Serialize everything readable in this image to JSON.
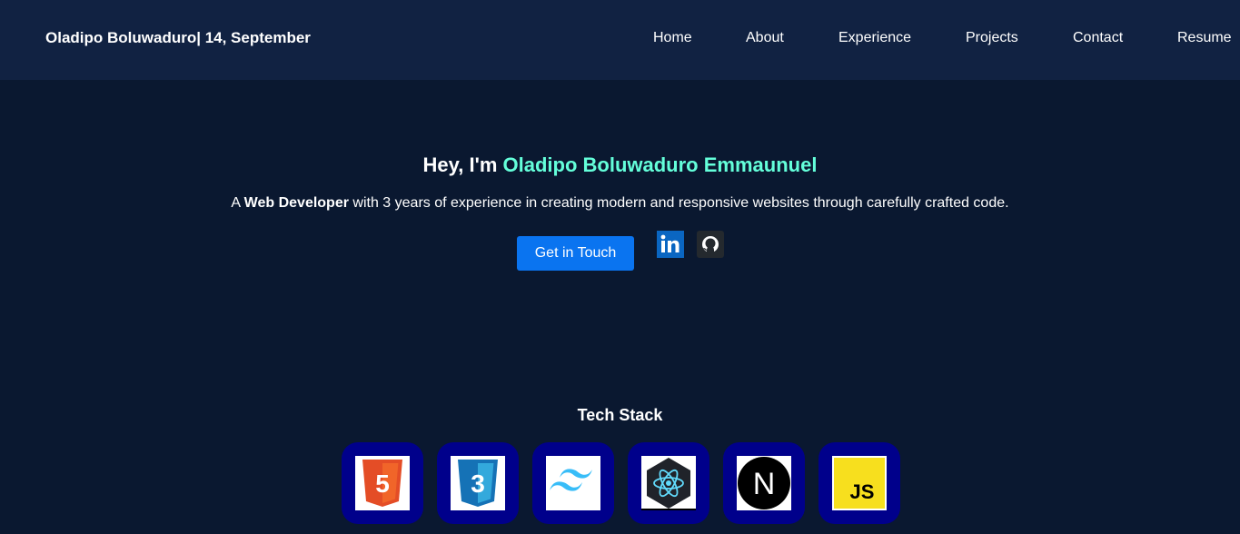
{
  "header": {
    "brand": "Oladipo Boluwaduro| 14, September",
    "nav": [
      {
        "label": "Home"
      },
      {
        "label": "About"
      },
      {
        "label": "Experience"
      },
      {
        "label": "Projects"
      },
      {
        "label": "Contact"
      },
      {
        "label": "Resume"
      }
    ]
  },
  "hero": {
    "greeting": "Hey, I'm ",
    "name": "Oladipo Boluwaduro Emmaunuel",
    "tagline_prefix": "A ",
    "tagline_role": "Web Developer",
    "tagline_suffix": " with 3 years of experience in creating modern and responsive websites through carefully crafted code.",
    "cta_label": "Get in Touch",
    "socials": [
      {
        "icon": "linkedin-icon"
      },
      {
        "icon": "github-icon"
      }
    ]
  },
  "tech_stack": {
    "title": "Tech Stack",
    "items": [
      {
        "icon": "html5-icon",
        "label": "5"
      },
      {
        "icon": "css3-icon",
        "label": "3"
      },
      {
        "icon": "tailwind-icon"
      },
      {
        "icon": "react-icon"
      },
      {
        "icon": "nextjs-icon",
        "label": "N"
      },
      {
        "icon": "javascript-icon",
        "label": "JS"
      }
    ]
  },
  "colors": {
    "background": "#0a1830",
    "navbar": "#112242",
    "accent": "#64ffda",
    "button": "#0a74f0",
    "tech_card": "#00008b"
  }
}
